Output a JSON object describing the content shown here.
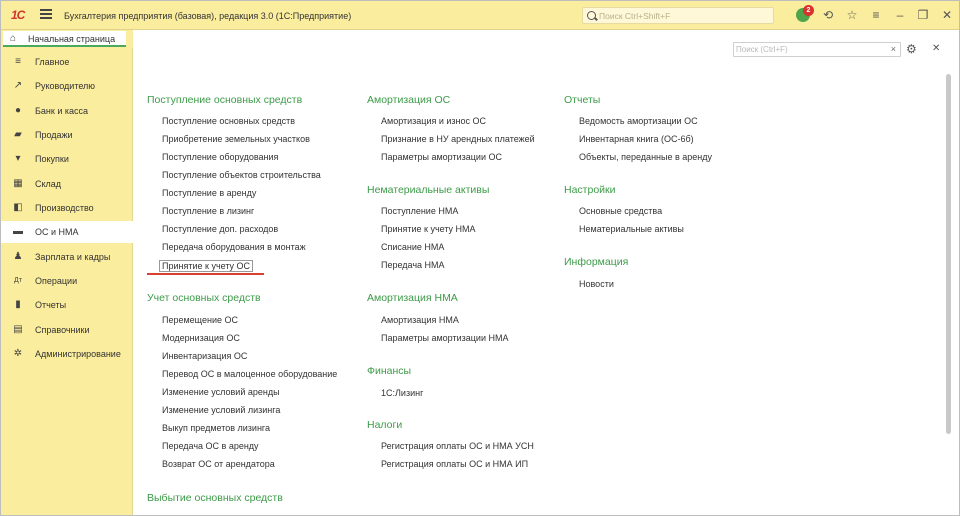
{
  "titlebar": {
    "logo": "1С",
    "title": "Бухгалтерия предприятия (базовая), редакция 3.0  (1С:Предприятие)",
    "search_placeholder": "Поиск Ctrl+Shift+F",
    "notifications_count": "2"
  },
  "tabs": {
    "home": "Начальная страница"
  },
  "sidebar": {
    "items": [
      {
        "label": "Главное",
        "icon": "menu-lines-icon"
      },
      {
        "label": "Руководителю",
        "icon": "trend-icon"
      },
      {
        "label": "Банк и касса",
        "icon": "coin-icon"
      },
      {
        "label": "Продажи",
        "icon": "shopping-bag-icon"
      },
      {
        "label": "Покупки",
        "icon": "cart-icon"
      },
      {
        "label": "Склад",
        "icon": "warehouse-icon"
      },
      {
        "label": "Производство",
        "icon": "production-icon"
      },
      {
        "label": "ОС и НМА",
        "icon": "truck-icon"
      },
      {
        "label": "Зарплата и кадры",
        "icon": "person-icon"
      },
      {
        "label": "Операции",
        "icon": "operations-icon"
      },
      {
        "label": "Отчеты",
        "icon": "bar-chart-icon"
      },
      {
        "label": "Справочники",
        "icon": "book-icon"
      },
      {
        "label": "Администрирование",
        "icon": "gear-icon"
      }
    ],
    "active": "ОС и НМА"
  },
  "main": {
    "search_placeholder": "Поиск (Ctrl+F)",
    "col1": {
      "s1_title": "Поступление основных средств",
      "s1_items": [
        "Поступление основных средств",
        "Приобретение земельных участков",
        "Поступление оборудования",
        "Поступление объектов строительства",
        "Поступление в аренду",
        "Поступление в лизинг",
        "Поступление доп. расходов",
        "Передача оборудования в монтаж",
        "Принятие к учету ОС"
      ],
      "s2_title": "Учет основных средств",
      "s2_items": [
        "Перемещение ОС",
        "Модернизация ОС",
        "Инвентаризация ОС",
        "Перевод ОС в малоценное оборудование",
        "Изменение условий аренды",
        "Изменение условий лизинга",
        "Выкуп предметов лизинга",
        "Передача ОС в аренду",
        "Возврат ОС от арендатора"
      ],
      "s3_title": "Выбытие основных средств"
    },
    "col2": {
      "s1_title": "Амортизация ОС",
      "s1_items": [
        "Амортизация и износ ОС",
        "Признание в НУ арендных платежей",
        "Параметры амортизации ОС"
      ],
      "s2_title": "Нематериальные активы",
      "s2_items": [
        "Поступление НМА",
        "Принятие к учету НМА",
        "Списание НМА",
        "Передача НМА"
      ],
      "s3_title": "Амортизация НМА",
      "s3_items": [
        "Амортизация НМА",
        "Параметры амортизации НМА"
      ],
      "s4_title": "Финансы",
      "s4_items": [
        "1С:Лизинг"
      ],
      "s5_title": "Налоги",
      "s5_items": [
        "Регистрация оплаты ОС и НМА УСН",
        "Регистрация оплаты ОС и НМА ИП"
      ]
    },
    "col3": {
      "s1_title": "Отчеты",
      "s1_items": [
        "Ведомость амортизации ОС",
        "Инвентарная книга (ОС-6б)",
        "Объекты, переданные в аренду"
      ],
      "s2_title": "Настройки",
      "s2_items": [
        "Основные средства",
        "Нематериальные активы"
      ],
      "s3_title": "Информация",
      "s3_items": [
        "Новости"
      ]
    }
  }
}
